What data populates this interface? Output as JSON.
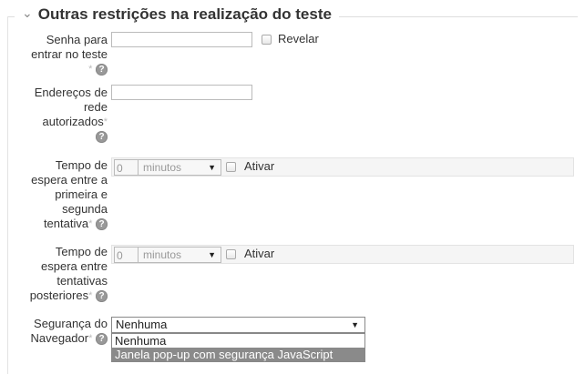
{
  "section": {
    "title": "Outras restrições na realização do teste",
    "chevron_icon": "chevron-down-icon"
  },
  "password": {
    "label_lines": [
      "Senha para",
      "entrar no teste"
    ],
    "value": "",
    "reveal_label": "Revelar"
  },
  "network": {
    "label_lines": [
      "Endereços de",
      "rede",
      "autorizados"
    ],
    "value": ""
  },
  "delay1": {
    "label_lines": [
      "Tempo de",
      "espera entre a",
      "primeira e",
      "segunda",
      "tentativa"
    ],
    "number": "0",
    "unit": "minutos",
    "enable_label": "Ativar"
  },
  "delay2": {
    "label_lines": [
      "Tempo de",
      "espera entre",
      "tentativas",
      "posteriores"
    ],
    "number": "0",
    "unit": "minutos",
    "enable_label": "Ativar"
  },
  "browser_security": {
    "label_lines": [
      "Segurança do",
      "Navegador"
    ],
    "selected": "Nenhuma",
    "options": [
      "Nenhuma",
      "Janela pop-up com segurança JavaScript"
    ],
    "highlighted_index": 1
  },
  "required_mark": "*",
  "help_glyph": "?",
  "colors": {
    "highlight": "#8a8a8a",
    "panel": "#f5f5f5",
    "border": "#bbbbbb"
  }
}
